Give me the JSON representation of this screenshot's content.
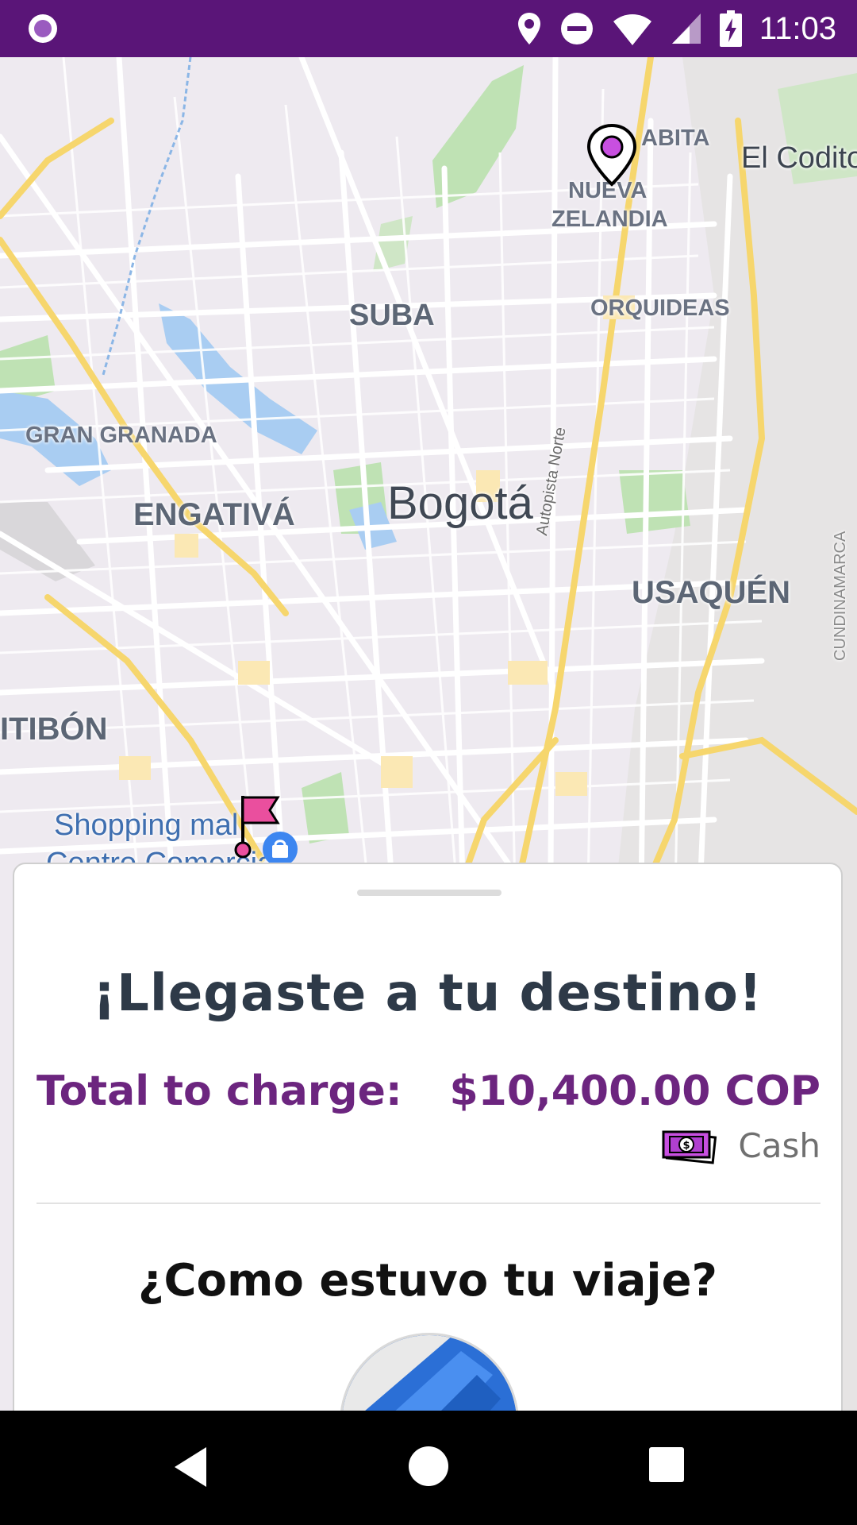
{
  "status_bar": {
    "time": "11:03",
    "icons": [
      "app-circle-icon",
      "location-icon",
      "do-not-disturb-icon",
      "wifi-icon",
      "signal-icon",
      "battery-charging-icon"
    ]
  },
  "map": {
    "labels": {
      "rabita": "ABITA",
      "el_codito": "El Codito",
      "nueva": "NUEVA",
      "zelandia": "ZELANDIA",
      "suba": "SUBA",
      "orquideas": "ORQUIDEAS",
      "gran_granada": "GRAN GRANADA",
      "engativa": "ENGATIVÁ",
      "bogota": "Bogotá",
      "autopista": "Autopista Norte",
      "usaquen": "USAQUÉN",
      "cundinamarca": "CUNDINAMARCA",
      "fontibon": "ITIBÓN",
      "shopping": "Shopping mal",
      "centro": "Centro Comercial"
    },
    "markers": [
      "origin-pin-icon",
      "destination-flag-icon",
      "shopping-icon"
    ]
  },
  "trip_sheet": {
    "title": "¡Llegaste a tu destino!",
    "total_label": "Total to charge:",
    "total_value": "$10,400.00 COP",
    "payment_method": "Cash",
    "rating_question": "¿Como estuvo tu viaje?"
  },
  "colors": {
    "status_bar": "#5a1578",
    "accent": "#6c257f",
    "pin": "#c84fe0",
    "flag": "#ea4f9e"
  }
}
